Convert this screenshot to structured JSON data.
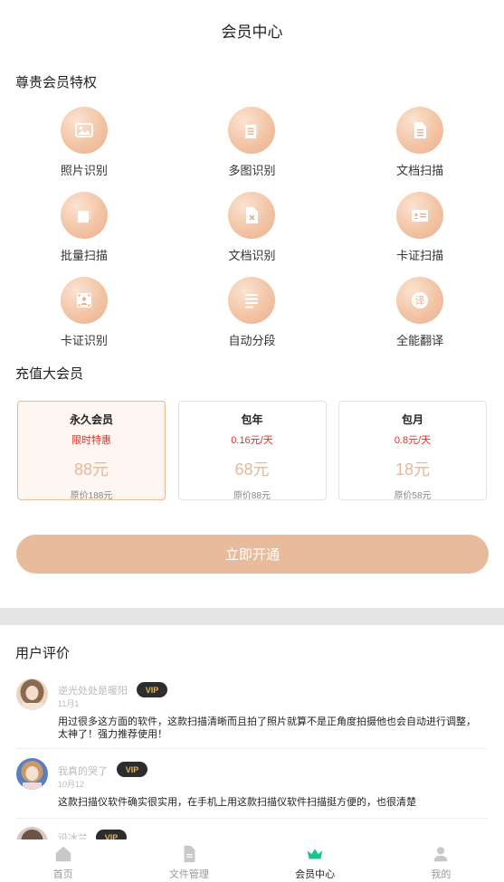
{
  "header": {
    "title": "会员中心"
  },
  "privileges": {
    "title": "尊贵会员特权",
    "items": [
      {
        "label": "照片识别",
        "icon": "photo-icon"
      },
      {
        "label": "多图识别",
        "icon": "multi-page-icon"
      },
      {
        "label": "文档扫描",
        "icon": "document-scan-icon"
      },
      {
        "label": "批量扫描",
        "icon": "batch-scan-icon"
      },
      {
        "label": "文档识别",
        "icon": "document-recognize-icon"
      },
      {
        "label": "卡证扫描",
        "icon": "id-card-scan-icon"
      },
      {
        "label": "卡证识别",
        "icon": "id-card-recognize-icon"
      },
      {
        "label": "自动分段",
        "icon": "paragraph-icon"
      },
      {
        "label": "全能翻译",
        "icon": "translate-icon"
      }
    ],
    "translate_glyph": "译"
  },
  "recharge": {
    "title": "充值大会员",
    "plans": [
      {
        "name": "永久会员",
        "sub": "限时特惠",
        "price": "88元",
        "original": "原价188元",
        "selected": true
      },
      {
        "name": "包年",
        "sub": "0.16元/天",
        "price": "68元",
        "original": "原价88元",
        "selected": false
      },
      {
        "name": "包月",
        "sub": "0.8元/天",
        "price": "18元",
        "original": "原价58元",
        "selected": false
      }
    ],
    "cta_label": "立即开通"
  },
  "reviews": {
    "title": "用户评价",
    "vip_label": "VIP",
    "items": [
      {
        "name": "逆光处处是暖阳",
        "date": "11月1",
        "text": "用过很多这方面的软件，这款扫描清晰而且拍了照片就算不是正角度拍摄他也会自动进行调整，太神了！强力推荐使用！"
      },
      {
        "name": "我真的哭了",
        "date": "10月12",
        "text": "这款扫描仪软件确实很实用，在手机上用这款扫描仪软件扫描挺方便的，也很清楚"
      },
      {
        "name": "设冰兰",
        "date": "",
        "text": ""
      }
    ]
  },
  "tabbar": {
    "tabs": [
      {
        "label": "首页",
        "icon": "home-icon",
        "active": false
      },
      {
        "label": "文件管理",
        "icon": "file-icon",
        "active": false
      },
      {
        "label": "会员中心",
        "icon": "crown-icon",
        "active": true
      },
      {
        "label": "我的",
        "icon": "user-icon",
        "active": false
      }
    ]
  },
  "colors": {
    "accent": "#e8bb9c",
    "price": "#e6b89a",
    "promo_red": "#e02e24",
    "active_tab_icon": "#1ec28b",
    "vip_badge_bg": "#2d2d2d",
    "vip_badge_text": "#e2b366"
  }
}
